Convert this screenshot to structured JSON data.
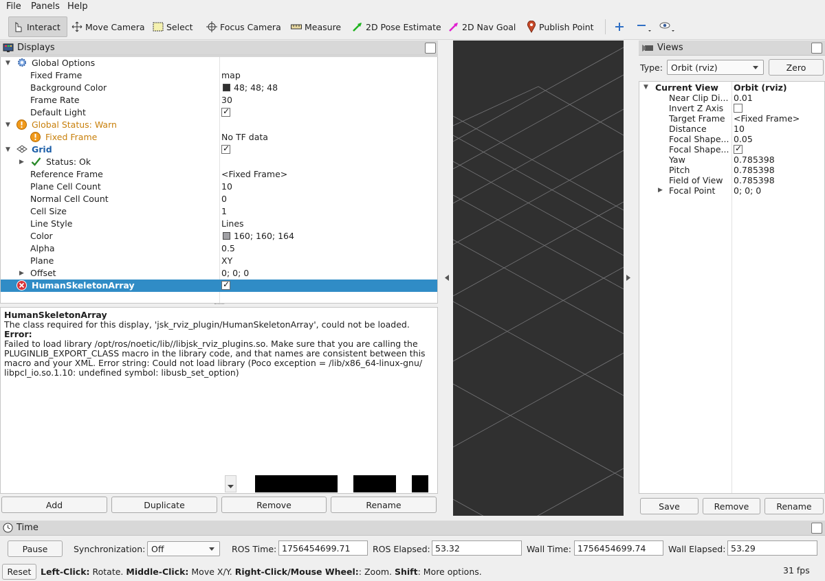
{
  "menu": {
    "file": "File",
    "panels": "Panels",
    "help": "Help"
  },
  "toolbar": {
    "interact": "Interact",
    "move_camera": "Move Camera",
    "select": "Select",
    "focus_camera": "Focus Camera",
    "measure": "Measure",
    "pose_estimate": "2D Pose Estimate",
    "nav_goal": "2D Nav Goal",
    "publish_point": "Publish Point"
  },
  "displays": {
    "title": "Displays",
    "rows": {
      "global_options": "Global Options",
      "fixed_frame": {
        "label": "Fixed Frame",
        "value": "map"
      },
      "background_color": {
        "label": "Background Color",
        "value": "48; 48; 48",
        "swatch": "#303030"
      },
      "frame_rate": {
        "label": "Frame Rate",
        "value": "30"
      },
      "default_light": {
        "label": "Default Light"
      },
      "global_status": "Global Status: Warn",
      "status_fixed_frame": {
        "label": "Fixed Frame",
        "value": "No TF data"
      },
      "grid": "Grid",
      "grid_status": "Status: Ok",
      "reference_frame": {
        "label": "Reference Frame",
        "value": "<Fixed Frame>"
      },
      "plane_cell_count": {
        "label": "Plane Cell Count",
        "value": "10"
      },
      "normal_cell_count": {
        "label": "Normal Cell Count",
        "value": "0"
      },
      "cell_size": {
        "label": "Cell Size",
        "value": "1"
      },
      "line_style": {
        "label": "Line Style",
        "value": "Lines"
      },
      "color": {
        "label": "Color",
        "value": "160; 160; 164",
        "swatch": "#a0a0a4"
      },
      "alpha": {
        "label": "Alpha",
        "value": "0.5"
      },
      "plane": {
        "label": "Plane",
        "value": "XY"
      },
      "offset": {
        "label": "Offset",
        "value": "0; 0; 0"
      },
      "human_skeleton": "HumanSkeletonArray"
    },
    "description": {
      "title": "HumanSkeletonArray",
      "line1": "The class required for this display, 'jsk_rviz_plugin/HumanSkeletonArray', could not be loaded.",
      "error_label": "Error:",
      "error_text": "Failed to load library /opt/ros/noetic/lib//libjsk_rviz_plugins.so. Make sure that you are calling the PLUGINLIB_EXPORT_CLASS macro in the library code, and that names are consistent between this macro and your XML. Error string: Could not load library (Poco exception = /lib/x86_64-linux-gnu/ libpcl_io.so.1.10: undefined symbol: libusb_set_option)"
    },
    "buttons": {
      "add": "Add",
      "duplicate": "Duplicate",
      "remove": "Remove",
      "rename": "Rename"
    }
  },
  "views": {
    "title": "Views",
    "type_label": "Type:",
    "type_value": "Orbit (rviz)",
    "zero": "Zero",
    "current_view": {
      "label": "Current View",
      "value": "Orbit (rviz)"
    },
    "rows": [
      {
        "label": "Near Clip Di...",
        "value": "0.01"
      },
      {
        "label": "Invert Z Axis",
        "value": ""
      },
      {
        "label": "Target Frame",
        "value": "<Fixed Frame>"
      },
      {
        "label": "Distance",
        "value": "10"
      },
      {
        "label": "Focal Shape...",
        "value": "0.05"
      },
      {
        "label": "Focal Shape...",
        "value": ""
      },
      {
        "label": "Yaw",
        "value": "0.785398"
      },
      {
        "label": "Pitch",
        "value": "0.785398"
      },
      {
        "label": "Field of View",
        "value": "0.785398"
      },
      {
        "label": "Focal Point",
        "value": "0; 0; 0"
      }
    ],
    "buttons": {
      "save": "Save",
      "remove": "Remove",
      "rename": "Rename"
    }
  },
  "time": {
    "title": "Time",
    "pause": "Pause",
    "sync_label": "Synchronization:",
    "sync_value": "Off",
    "ros_time_label": "ROS Time:",
    "ros_time": "1756454699.71",
    "ros_elapsed_label": "ROS Elapsed:",
    "ros_elapsed": "53.32",
    "wall_time_label": "Wall Time:",
    "wall_time": "1756454699.74",
    "wall_elapsed_label": "Wall Elapsed:",
    "wall_elapsed": "53.29"
  },
  "status": {
    "reset": "Reset",
    "left_click": "Left-Click:",
    "rotate": " Rotate. ",
    "middle_click": "Middle-Click:",
    "move": " Move X/Y. ",
    "right_click": "Right-Click/Mouse Wheel:",
    "zoom": ": Zoom. ",
    "shift": "Shift",
    "more": ": More options.",
    "fps": "31 fps"
  },
  "colors": {
    "selection": "#308cc6",
    "warning": "#c87f0a",
    "render_bg": "#303030",
    "grid_line": "#a0a0a4"
  }
}
